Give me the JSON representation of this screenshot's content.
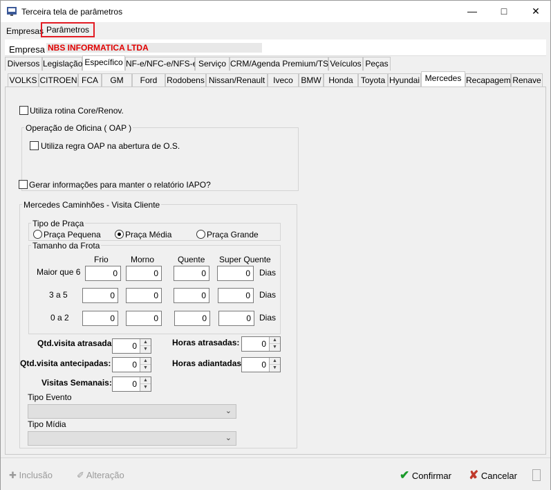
{
  "window": {
    "title": "Terceira tela de parâmetros"
  },
  "menu": {
    "items": [
      "Empresas",
      "Parâmetros"
    ]
  },
  "company": {
    "label": "Empresa",
    "name": "NBS INFORMATICA LTDA"
  },
  "main_tabs": [
    "Diversos",
    "Legislação",
    "Específico",
    "NF-e/NFC-e/NFS-e",
    "Serviço",
    "CRM/Agenda Premium/TSW",
    "Veículos",
    "Peças"
  ],
  "brand_tabs": [
    "VOLKS",
    "CITROEN",
    "FCA",
    "GM",
    "Ford",
    "Rodobens",
    "Nissan/Renault",
    "Iveco",
    "BMW",
    "Honda",
    "Toyota",
    "Hyundai",
    "Mercedes",
    "Recapagem",
    "Renave"
  ],
  "options": {
    "core_renov": "Utiliza rotina Core/Renov.",
    "oap_group": "Operação de Oficina ( OAP )",
    "oap_rule": "Utiliza regra OAP na abertura de O.S.",
    "iapo": "Gerar  informações para manter o relatório IAPO?"
  },
  "visit": {
    "group": "Mercedes Caminhões - Visita Cliente",
    "praca_group": "Tipo de Praça",
    "praca_options": [
      "Praça Pequena",
      "Praça Média",
      "Praça Grande"
    ],
    "praca_selected": "Praça Média",
    "frota_group": "Tamanho da Frota",
    "columns": [
      "Frio",
      "Morno",
      "Quente",
      "Super Quente"
    ],
    "rows": [
      {
        "label": "Maior que 6",
        "values": [
          "0",
          "0",
          "0",
          "0"
        ],
        "unit": "Dias"
      },
      {
        "label": "3 a 5",
        "values": [
          "0",
          "0",
          "0",
          "0"
        ],
        "unit": "Dias"
      },
      {
        "label": "0 a 2",
        "values": [
          "0",
          "0",
          "0",
          "0"
        ],
        "unit": "Dias"
      }
    ],
    "qtd_atrasadas_label": "Qtd.visita atrasadas:",
    "qtd_atrasadas": "0",
    "horas_atrasadas_label": "Horas atrasadas:",
    "horas_atrasadas": "0",
    "qtd_antecipadas_label": "Qtd.visita antecipadas:",
    "qtd_antecipadas": "0",
    "horas_adiantadas_label": "Horas adiantadas:",
    "horas_adiantadas": "0",
    "visitas_semanais_label": "Visitas Semanais:",
    "visitas_semanais": "0",
    "tipo_evento_label": "Tipo Evento",
    "tipo_midia_label": "Tipo Mídia"
  },
  "buttons": {
    "inclusao": "Inclusão",
    "alteracao": "Alteração",
    "confirmar": "Confirmar",
    "cancelar": "Cancelar"
  },
  "colors": {
    "highlight": "#e21b23",
    "company_name": "#e00000",
    "confirm": "#1a9a2a",
    "cancel": "#c0392b"
  }
}
